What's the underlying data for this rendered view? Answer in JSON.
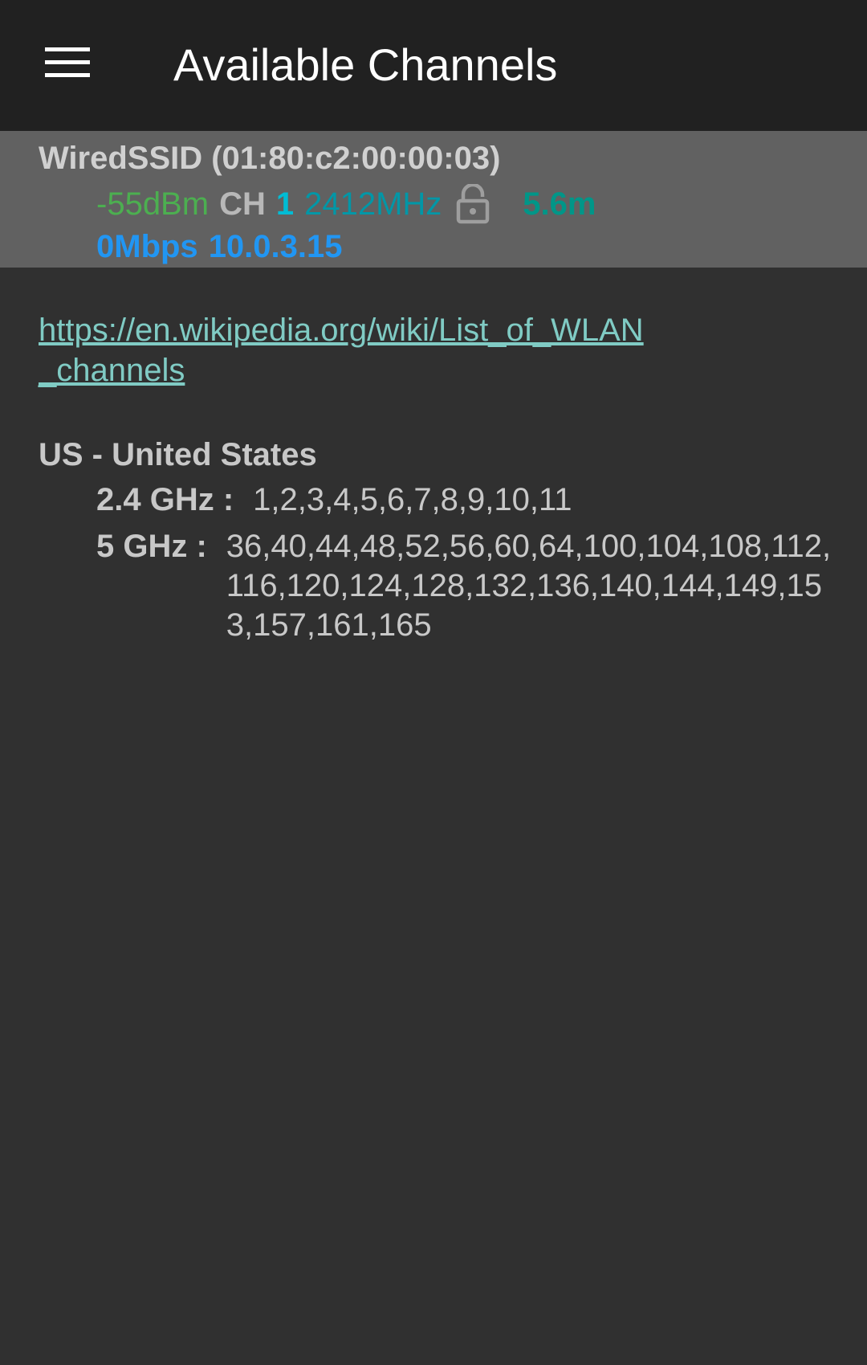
{
  "app_bar": {
    "title": "Available Channels",
    "menu_icon": "menu-icon"
  },
  "connection": {
    "ssid_line": "WiredSSID (01:80:c2:00:00:03)",
    "level": "-55dBm",
    "channel_label": "CH",
    "channel": "1",
    "frequency": "2412MHz",
    "security_icon": "lock-open-icon",
    "distance": "5.6m",
    "speed": "0Mbps",
    "ip_address": "10.0.3.15"
  },
  "content": {
    "link": "https://en.wikipedia.org/wiki/List_of_WLAN_channels",
    "country": "US - United States",
    "bands": [
      {
        "label": "2.4 GHz :",
        "channels": "1,2,3,4,5,6,7,8,9,10,11"
      },
      {
        "label": "5 GHz :",
        "channels": "36,40,44,48,52,56,60,64,100,104,108,112,116,120,124,128,132,136,140,144,149,153,157,161,165"
      }
    ]
  },
  "colors": {
    "app_bar": "#212121",
    "background": "#303030",
    "connection_card": "#616161",
    "level": "#4caf50",
    "channel": "#00bcd4",
    "frequency": "#0097a7",
    "distance": "#009688",
    "speed": "#2196f3",
    "link": "#80cbc4"
  }
}
